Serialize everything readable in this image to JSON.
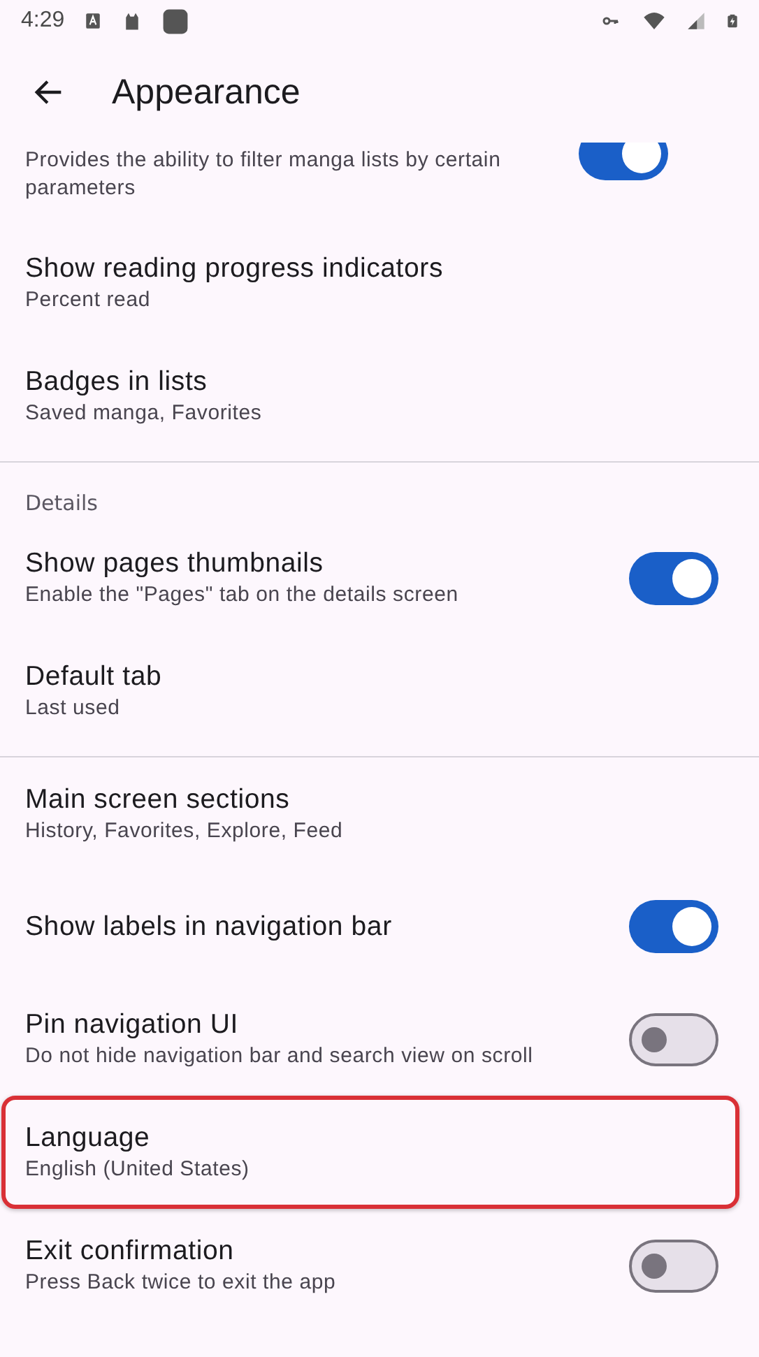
{
  "status_bar": {
    "time": "4:29"
  },
  "app_bar": {
    "title": "Appearance"
  },
  "sections": [
    {
      "items": [
        {
          "kind": "switch",
          "summary": "Provides the ability to filter manga lists by certain parameters",
          "on": true,
          "cut": true
        },
        {
          "kind": "text",
          "title": "Show reading progress indicators",
          "summary": "Percent read"
        },
        {
          "kind": "text",
          "title": "Badges in lists",
          "summary": "Saved manga, Favorites"
        }
      ]
    },
    {
      "header": "Details",
      "items": [
        {
          "kind": "switch",
          "title": "Show pages thumbnails",
          "summary": "Enable the \"Pages\" tab on the details screen",
          "on": true
        },
        {
          "kind": "text",
          "title": "Default tab",
          "summary": "Last used"
        }
      ]
    },
    {
      "items": [
        {
          "kind": "text",
          "title": "Main screen sections",
          "summary": "History, Favorites, Explore, Feed"
        },
        {
          "kind": "switch",
          "title": "Show labels in navigation bar",
          "on": true
        },
        {
          "kind": "switch",
          "title": "Pin navigation UI",
          "summary": "Do not hide navigation bar and search view on scroll",
          "on": false
        },
        {
          "kind": "text",
          "title": "Language",
          "summary": "English (United States)",
          "highlighted": true
        },
        {
          "kind": "switch",
          "title": "Exit confirmation",
          "summary": "Press Back twice to exit the app",
          "on": false
        }
      ]
    }
  ]
}
